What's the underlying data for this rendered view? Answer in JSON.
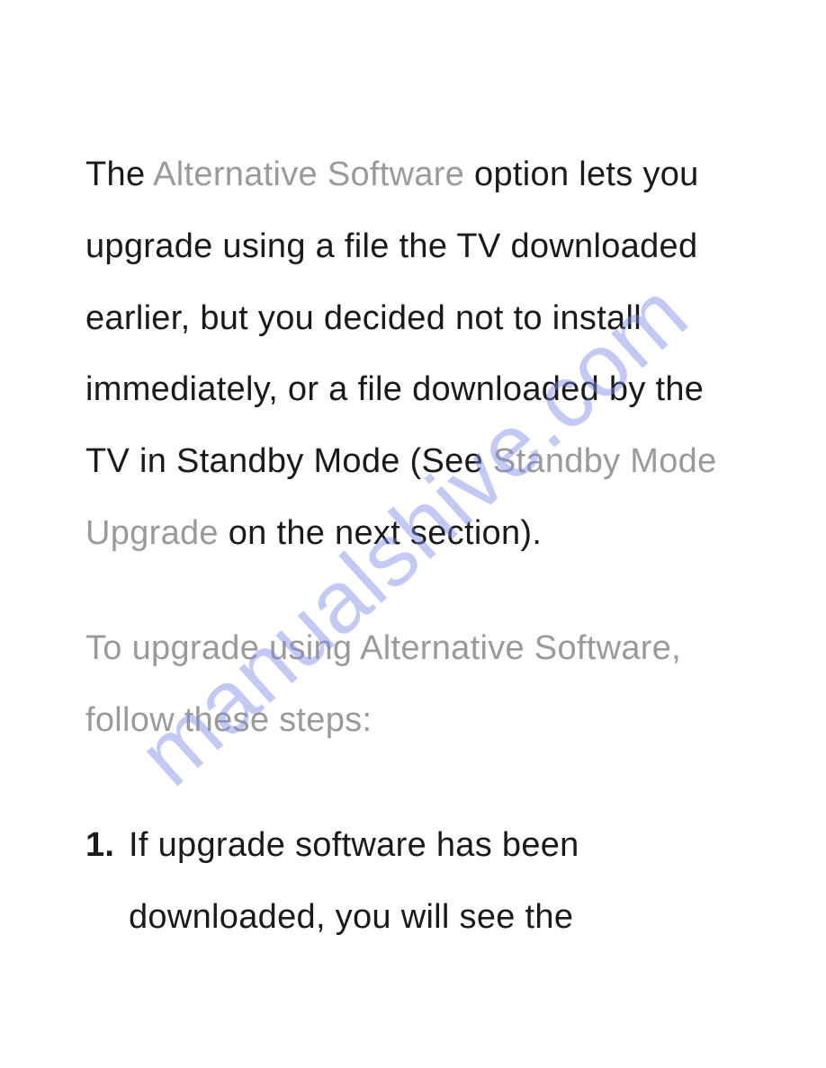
{
  "watermark": "manualshive.com",
  "para1": {
    "t1": "The ",
    "t2": "Alternative Software",
    "t3": " option lets you upgrade using a file the TV downloaded earlier, but you decided not to install immediately, or a file downloaded by the TV in Standby Mode (See ",
    "t4": "Standby Mode Upgrade",
    "t5": " on the next section)."
  },
  "para2": "To upgrade using Alternative Software, follow these steps:",
  "list": {
    "num1": "1.",
    "item1": "If upgrade software has been downloaded, you will see the"
  }
}
